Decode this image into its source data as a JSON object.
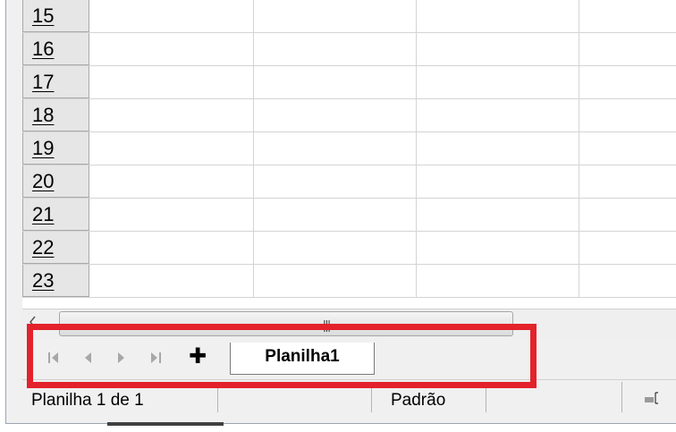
{
  "rows": [
    "15",
    "16",
    "17",
    "18",
    "19",
    "20",
    "21",
    "22",
    "23"
  ],
  "sheet_nav": {
    "first_icon": "first-sheet-icon",
    "prev_icon": "previous-sheet-icon",
    "next_icon": "next-sheet-icon",
    "last_icon": "last-sheet-icon",
    "add_label": "✚"
  },
  "sheet_tabs": [
    {
      "label": "Planilha1"
    }
  ],
  "scrollbar": {
    "grip": "|||"
  },
  "status": {
    "sheet_info": "Planilha 1 de 1",
    "page_style": "Padrão"
  },
  "colors": {
    "highlight": "#e3222b",
    "header_bg": "#e6e6e6",
    "grid_line": "#d4d4d4"
  }
}
